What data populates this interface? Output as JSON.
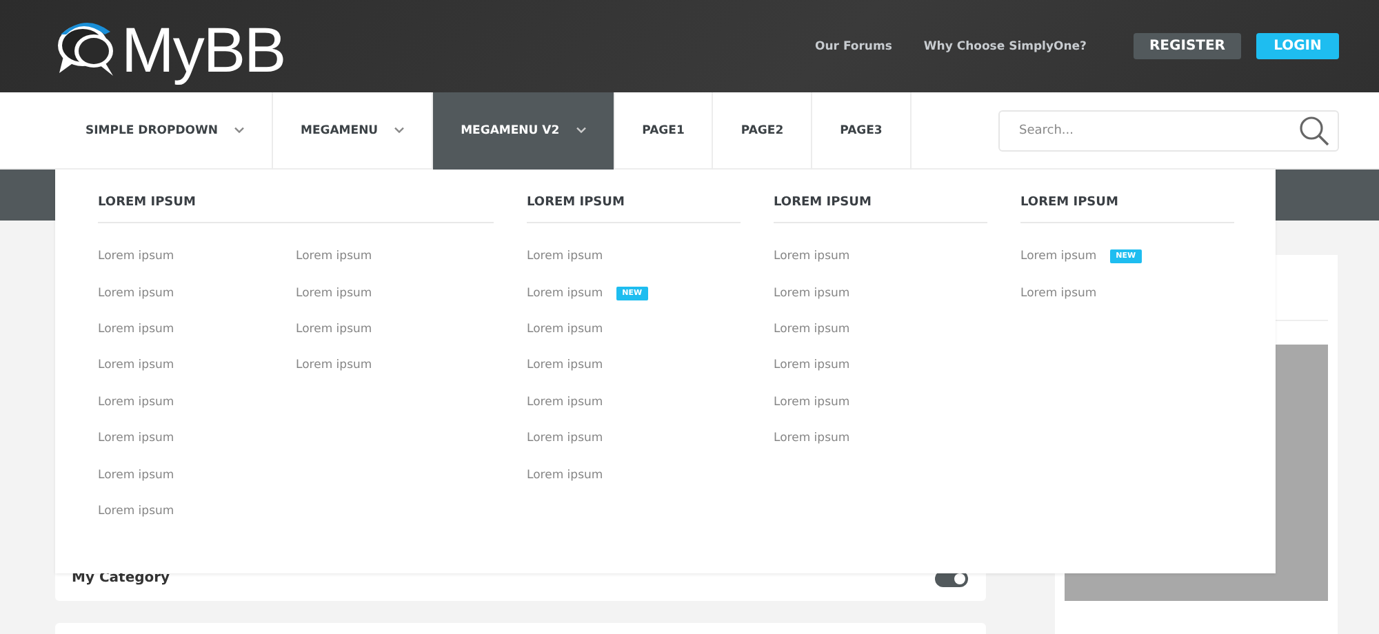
{
  "header": {
    "logo": "MyBB",
    "links": [
      "Our Forums",
      "Why Choose SimplyOne?"
    ],
    "buttons": [
      {
        "label": "REGISTER",
        "kind": "secondary"
      },
      {
        "label": "LOGIN",
        "kind": "primary"
      }
    ]
  },
  "nav": {
    "items": [
      {
        "label": "SIMPLE DROPDOWN",
        "caret": true,
        "selected": false
      },
      {
        "label": "MEGAMENU",
        "caret": true,
        "selected": false
      },
      {
        "label": "MEGAMENU V2",
        "caret": true,
        "selected": true
      },
      {
        "label": "PAGE1",
        "caret": false,
        "selected": false
      },
      {
        "label": "PAGE2",
        "caret": false,
        "selected": false
      },
      {
        "label": "PAGE3",
        "caret": false,
        "selected": false
      }
    ],
    "search": {
      "placeholder": "Search..."
    }
  },
  "megamenu": {
    "columns": [
      {
        "heading": "LOREM IPSUM",
        "lists": [
          [
            {
              "label": "Lorem ipsum"
            },
            {
              "label": "Lorem ipsum"
            },
            {
              "label": "Lorem ipsum"
            },
            {
              "label": "Lorem ipsum"
            },
            {
              "label": "Lorem ipsum"
            },
            {
              "label": "Lorem ipsum"
            },
            {
              "label": "Lorem ipsum"
            },
            {
              "label": "Lorem ipsum"
            }
          ],
          [
            {
              "label": "Lorem ipsum"
            },
            {
              "label": "Lorem ipsum"
            },
            {
              "label": "Lorem ipsum"
            },
            {
              "label": "Lorem ipsum"
            }
          ]
        ]
      },
      {
        "heading": "LOREM IPSUM",
        "lists": [
          [
            {
              "label": "Lorem ipsum"
            },
            {
              "label": "Lorem ipsum",
              "badge": "NEW"
            },
            {
              "label": "Lorem ipsum"
            },
            {
              "label": "Lorem ipsum"
            },
            {
              "label": "Lorem ipsum"
            },
            {
              "label": "Lorem ipsum"
            },
            {
              "label": "Lorem ipsum"
            }
          ]
        ]
      },
      {
        "heading": "LOREM IPSUM",
        "lists": [
          [
            {
              "label": "Lorem ipsum"
            },
            {
              "label": "Lorem ipsum"
            },
            {
              "label": "Lorem ipsum"
            },
            {
              "label": "Lorem ipsum"
            },
            {
              "label": "Lorem ipsum"
            },
            {
              "label": "Lorem ipsum"
            }
          ]
        ]
      },
      {
        "heading": "LOREM IPSUM",
        "lists": [
          [
            {
              "label": "Lorem ipsum",
              "badge": "NEW"
            },
            {
              "label": "Lorem ipsum"
            }
          ]
        ]
      }
    ]
  },
  "category": {
    "title": "My Category",
    "toggle_on": true
  }
}
